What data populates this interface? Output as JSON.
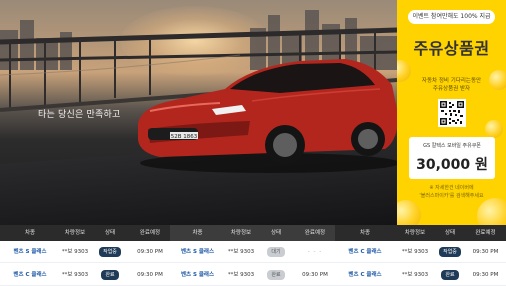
{
  "hero": {
    "caption": "타는 당신은 만족하고",
    "plate": "52B 1863"
  },
  "promo": {
    "event_pill": "이벤트 참여만해도 100% 지급",
    "title": "주유상품권",
    "desc_line1": "자동차 정비 기다리는동안",
    "desc_line2": "주유상품권 받자",
    "card_label": "GS 칼텍스 모바일 주유쿠폰",
    "amount": "30,000 원",
    "note_line1": "※ 자세한건 네이버에",
    "note_line2": "'블러스마이카'를 검색해주세요"
  },
  "table": {
    "groups": [
      {
        "headers": [
          "차종",
          "차량정보",
          "상태",
          "완료예정"
        ]
      },
      {
        "headers": [
          "차종",
          "차량정보",
          "상태",
          "완료예정"
        ]
      },
      {
        "headers": [
          "차종",
          "차량정보",
          "상태",
          "완료예정"
        ]
      }
    ],
    "rows": [
      [
        {
          "model": "벤츠 S 클래스",
          "info": "**보 9303",
          "status": "작업중",
          "status_style": "dark",
          "eta": "09:30 PM"
        },
        {
          "model": "벤츠 S 클래스",
          "info": "**보 9303",
          "status": "대기",
          "status_style": "gray",
          "eta": "- - -"
        },
        {
          "model": "벤츠 C 클래스",
          "info": "**보 9303",
          "status": "작업중",
          "status_style": "dark",
          "eta": "09:30 PM"
        }
      ],
      [
        {
          "model": "벤츠 C 클래스",
          "info": "**보 9303",
          "status": "완료",
          "status_style": "dark",
          "eta": "09:30 PM"
        },
        {
          "model": "벤츠 S 클래스",
          "info": "**보 9303",
          "status": "완료",
          "status_style": "gray",
          "eta": "09:30 PM"
        },
        {
          "model": "벤츠 C 클래스",
          "info": "**보 9303",
          "status": "완료",
          "status_style": "dark",
          "eta": "09:30 PM"
        }
      ]
    ]
  },
  "colors": {
    "promo_bg": "#ffd300",
    "header_bg": "#2b2b2b",
    "model_text": "#1f5aa6",
    "badge_dark": "#1f3b57",
    "badge_gray": "#c9cdd2"
  }
}
